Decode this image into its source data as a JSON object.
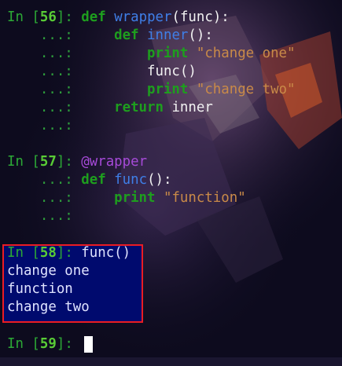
{
  "cells": [
    {
      "prompt": "In [",
      "number": "56",
      "close": "]:",
      "lines": [
        [
          "def",
          "wrapper",
          "(func):"
        ],
        [
          "def",
          "inner",
          "():"
        ],
        [
          "print",
          "\"change one\""
        ],
        [
          "func()"
        ],
        [
          "print",
          "\"change two\""
        ],
        [
          "return",
          "inner"
        ]
      ],
      "cont": "...:"
    },
    {
      "prompt": "In [",
      "number": "57",
      "close": "]:",
      "decorator": "@wrapper",
      "def_kw": "def",
      "func_name": "func",
      "func_rest": "():",
      "print_kw": "print",
      "print_str": "\"function\"",
      "cont": "...:"
    },
    {
      "prompt": "In [",
      "number": "58",
      "close": "]:",
      "code": "func()",
      "output": [
        "change one",
        "function",
        "change two"
      ]
    },
    {
      "prompt": "In [",
      "number": "59",
      "close": "]:"
    }
  ],
  "colors": {
    "highlight_border": "#ea1c24",
    "highlight_bg": "#000a6e",
    "prompt_green": "#2ca836",
    "keyword_green": "#1e9e1e",
    "function_blue": "#3f7fe8",
    "string_orange": "#c98a48",
    "decorator_purple": "#a64ad8"
  }
}
